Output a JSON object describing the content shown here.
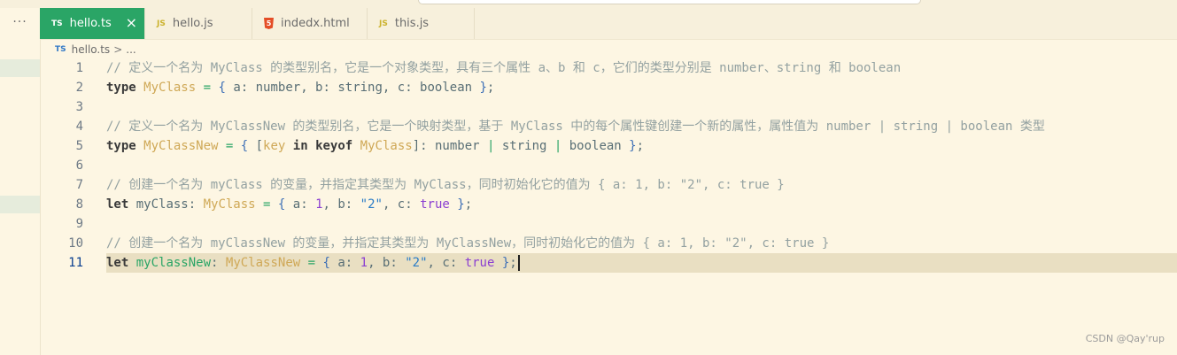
{
  "tabs": [
    {
      "icon": "TS",
      "label": "hello.ts",
      "active": true
    },
    {
      "icon": "JS",
      "label": "hello.js",
      "active": false
    },
    {
      "icon": "5",
      "label": "indedx.html",
      "active": false
    },
    {
      "icon": "JS",
      "label": "this.js",
      "active": false
    }
  ],
  "close_glyph": "×",
  "more_glyph": "···",
  "breadcrumb": {
    "icon": "TS",
    "file": "hello.ts",
    "sep": ">",
    "rest": "..."
  },
  "lines": [
    {
      "n": "1",
      "tokens": [
        {
          "t": "// 定义一个名为 MyClass 的类型别名，它是一个对象类型，具有三个属性 a、b 和 c，它们的类型分别是 number、string 和 boolean",
          "k": "cm"
        }
      ]
    },
    {
      "n": "2",
      "tokens": [
        {
          "t": "type",
          "k": "kw"
        },
        {
          "t": " ",
          "k": "pl"
        },
        {
          "t": "MyClass",
          "k": "ty"
        },
        {
          "t": " = ",
          "k": "op"
        },
        {
          "t": "{",
          "k": "br"
        },
        {
          "t": " a: number, b: string, c: boolean ",
          "k": "pl"
        },
        {
          "t": "}",
          "k": "br"
        },
        {
          "t": ";",
          "k": "pl"
        }
      ]
    },
    {
      "n": "3",
      "tokens": []
    },
    {
      "n": "4",
      "tokens": [
        {
          "t": "// 定义一个名为 MyClassNew 的类型别名，它是一个映射类型，基于 MyClass 中的每个属性键创建一个新的属性，属性值为 number | string | boolean 类型",
          "k": "cm"
        }
      ]
    },
    {
      "n": "5",
      "tokens": [
        {
          "t": "type",
          "k": "kw"
        },
        {
          "t": " ",
          "k": "pl"
        },
        {
          "t": "MyClassNew",
          "k": "ty"
        },
        {
          "t": " = ",
          "k": "op"
        },
        {
          "t": "{",
          "k": "br"
        },
        {
          "t": " [",
          "k": "pl"
        },
        {
          "t": "key",
          "k": "ty"
        },
        {
          "t": " ",
          "k": "pl"
        },
        {
          "t": "in",
          "k": "kw"
        },
        {
          "t": " ",
          "k": "pl"
        },
        {
          "t": "keyof",
          "k": "kw"
        },
        {
          "t": " ",
          "k": "pl"
        },
        {
          "t": "MyClass",
          "k": "ty"
        },
        {
          "t": "]: number ",
          "k": "pl"
        },
        {
          "t": "|",
          "k": "op"
        },
        {
          "t": " string ",
          "k": "pl"
        },
        {
          "t": "|",
          "k": "op"
        },
        {
          "t": " boolean ",
          "k": "pl"
        },
        {
          "t": "}",
          "k": "br"
        },
        {
          "t": ";",
          "k": "pl"
        }
      ]
    },
    {
      "n": "6",
      "tokens": []
    },
    {
      "n": "7",
      "tokens": [
        {
          "t": "// 创建一个名为 myClass 的变量，并指定其类型为 MyClass，同时初始化它的值为 { a: 1, b: \"2\", c: true }",
          "k": "cm"
        }
      ]
    },
    {
      "n": "8",
      "tokens": [
        {
          "t": "let",
          "k": "kw"
        },
        {
          "t": " myClass: ",
          "k": "pl"
        },
        {
          "t": "MyClass",
          "k": "ty"
        },
        {
          "t": " = ",
          "k": "op"
        },
        {
          "t": "{",
          "k": "br"
        },
        {
          "t": " a: ",
          "k": "pl"
        },
        {
          "t": "1",
          "k": "num"
        },
        {
          "t": ", b: ",
          "k": "pl"
        },
        {
          "t": "\"2\"",
          "k": "str"
        },
        {
          "t": ", c: ",
          "k": "pl"
        },
        {
          "t": "true",
          "k": "bool"
        },
        {
          "t": " ",
          "k": "pl"
        },
        {
          "t": "}",
          "k": "br"
        },
        {
          "t": ";",
          "k": "pl"
        }
      ]
    },
    {
      "n": "9",
      "tokens": []
    },
    {
      "n": "10",
      "tokens": [
        {
          "t": "// 创建一个名为 myClassNew 的变量，并指定其类型为 MyClassNew，同时初始化它的值为 { a: 1, b: \"2\", c: true }",
          "k": "cm"
        }
      ]
    },
    {
      "n": "11",
      "current": true,
      "tokens": [
        {
          "t": "let",
          "k": "kw"
        },
        {
          "t": " ",
          "k": "pl"
        },
        {
          "t": "myClassNew",
          "k": "op"
        },
        {
          "t": ": ",
          "k": "pl"
        },
        {
          "t": "MyClassNew",
          "k": "ty"
        },
        {
          "t": " = ",
          "k": "op"
        },
        {
          "t": "{",
          "k": "br"
        },
        {
          "t": " a: ",
          "k": "pl"
        },
        {
          "t": "1",
          "k": "num"
        },
        {
          "t": ", b: ",
          "k": "pl"
        },
        {
          "t": "\"2\"",
          "k": "str"
        },
        {
          "t": ", c: ",
          "k": "pl"
        },
        {
          "t": "true",
          "k": "bool"
        },
        {
          "t": " ",
          "k": "pl"
        },
        {
          "t": "}",
          "k": "br"
        },
        {
          "t": ";",
          "k": "pl"
        }
      ]
    }
  ],
  "watermark": "CSDN @Qay'rup",
  "colors": {
    "accent": "#2aa566",
    "background": "#fdf6e3",
    "current_line": "#e9dfc2"
  }
}
